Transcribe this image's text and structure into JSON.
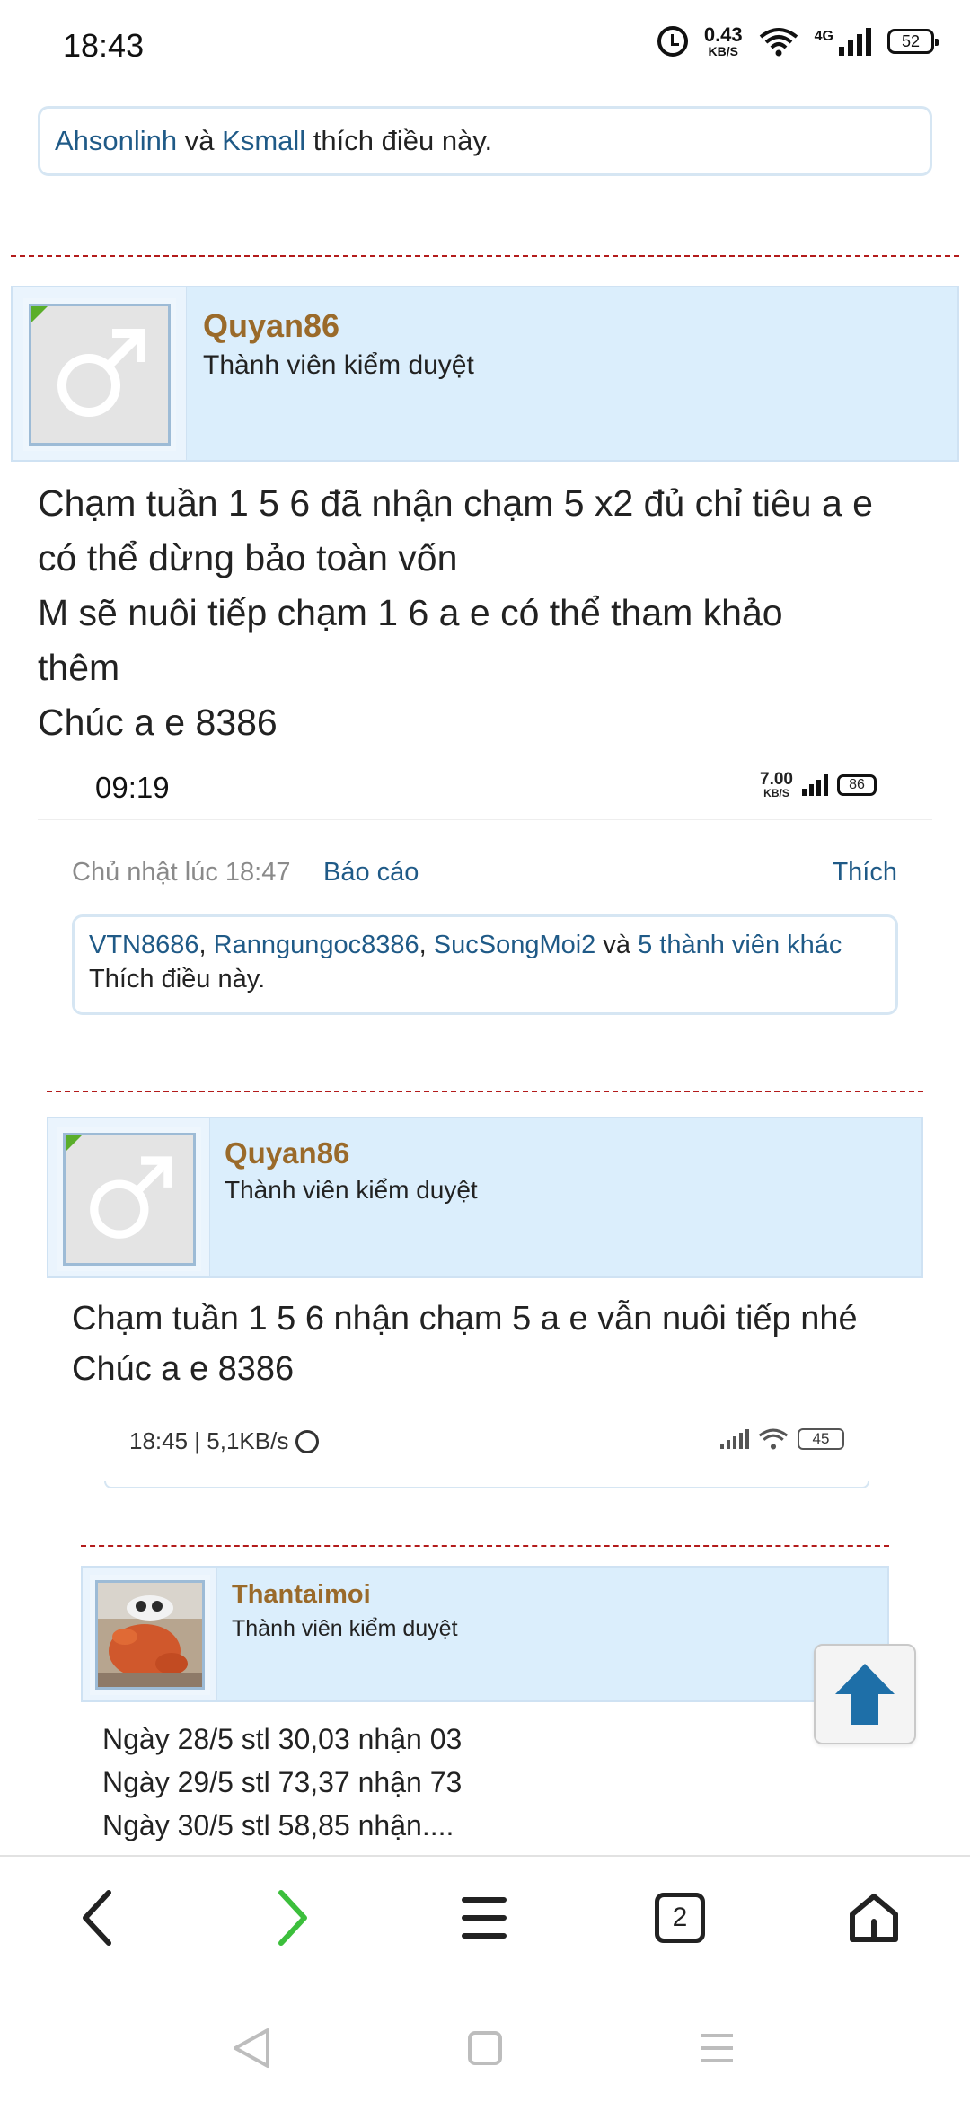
{
  "status_bar": {
    "time": "18:43",
    "speed_value": "0.43",
    "speed_unit": "KB/S",
    "network": "4G",
    "battery": "52"
  },
  "top_likes": {
    "user1": "Ahsonlinh",
    "and": "và",
    "user2": "Ksmall",
    "suffix": "thích điều này."
  },
  "post1": {
    "username": "Quyan86",
    "role": "Thành viên kiểm duyệt",
    "lines": [
      "Chạm tuần 1 5 6 đã nhận chạm 5 x2 đủ chỉ tiêu a e",
      "có thể dừng bảo toàn vốn",
      "M sẽ nuôi tiếp chạm 1 6 a e có thể tham khảo",
      "thêm",
      "Chúc a e 8386"
    ],
    "screenshot_status": {
      "time": "09:19",
      "speed_value": "7.00",
      "speed_unit": "KB/S",
      "battery": "86"
    },
    "timestamp": "Chủ nhật lúc 18:47",
    "report": "Báo cáo",
    "like": "Thích",
    "likes": {
      "user1": "VTN8686",
      "sep1": ",",
      "user2": "Ranngungoc8386",
      "sep2": ",",
      "user3": "SucSongMoi2",
      "and": "và",
      "others": "5 thành viên khác",
      "suffix": "Thích điều này."
    }
  },
  "post2": {
    "username": "Quyan86",
    "role": "Thành viên kiểm duyệt",
    "lines": [
      "Chạm tuần 1 5 6 nhận chạm 5 a e vẫn nuôi tiếp nhé",
      "Chúc a e 8386"
    ],
    "screenshot_status": {
      "time_speed": "18:45 | 5,1KB/s",
      "battery": "45"
    }
  },
  "post3": {
    "username": "Thantaimoi",
    "role": "Thành viên kiểm duyệt",
    "lines": [
      "Ngày 28/5 stl 30,03 nhận 03",
      "Ngày 29/5 stl 73,37 nhận 73",
      "Ngày 30/5 stl 58,85 nhận...."
    ]
  },
  "toolbar": {
    "tab_count": "2"
  }
}
